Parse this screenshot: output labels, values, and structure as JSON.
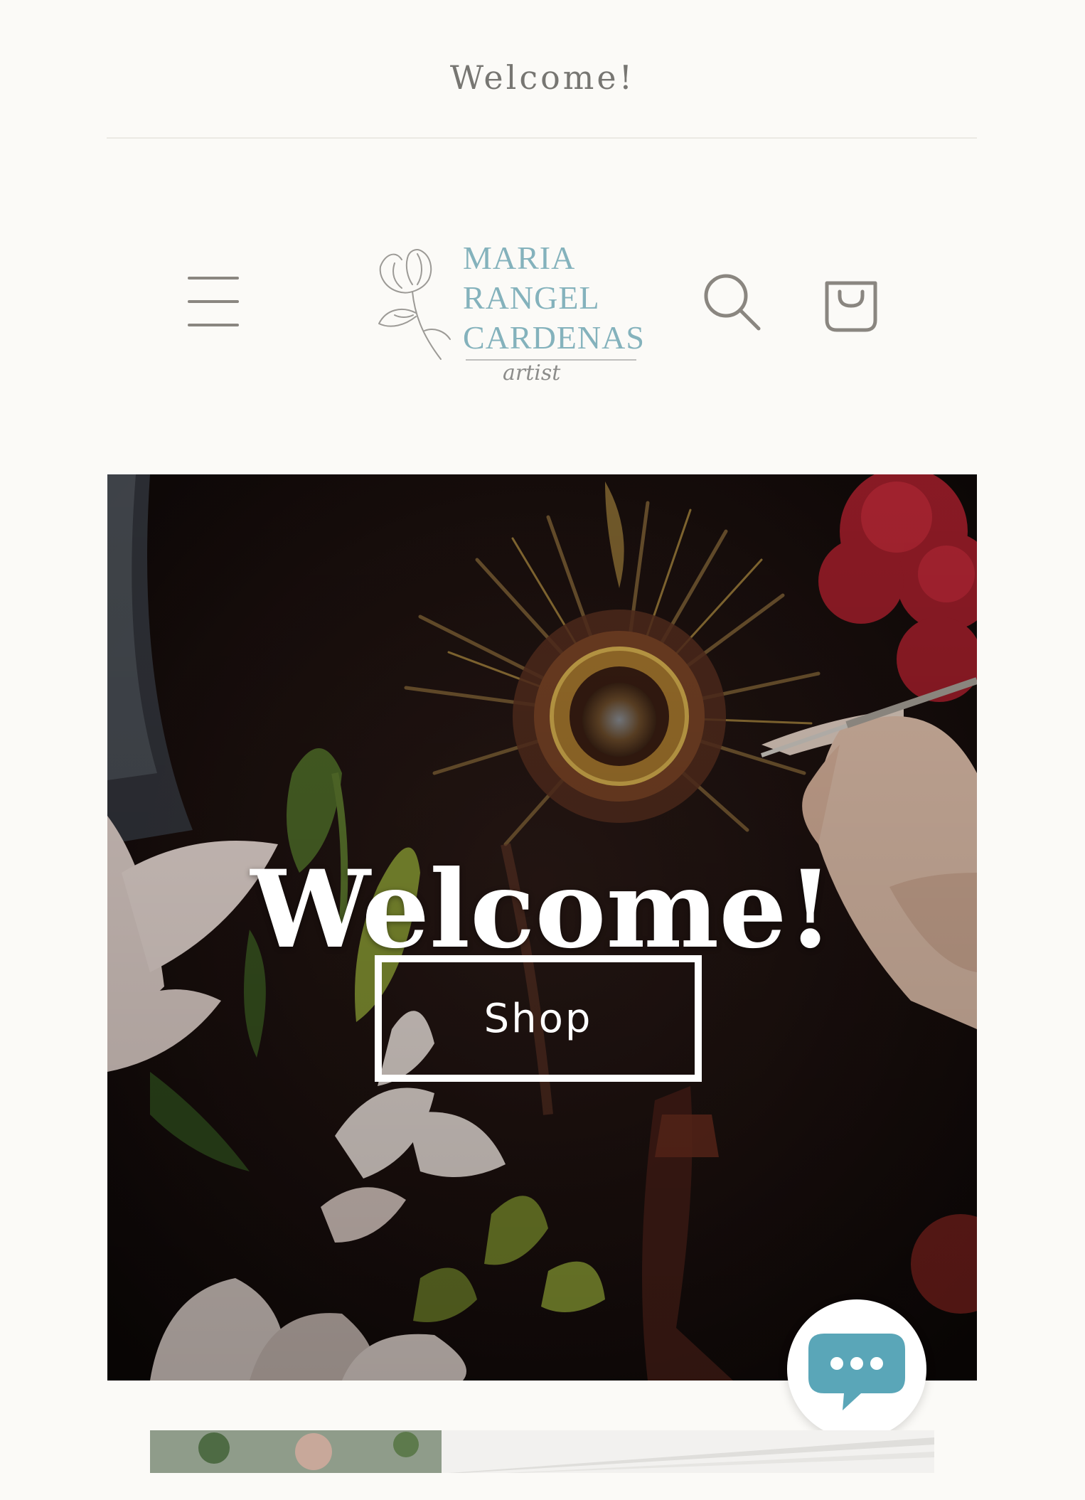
{
  "announcement": {
    "text": "Welcome!"
  },
  "header": {
    "logo": {
      "line1": "MARIA",
      "line2": "RANGEL",
      "line3": "CARDENAS",
      "subtitle": "artist"
    },
    "icons": {
      "menu": "hamburger-menu-icon",
      "search": "search-icon",
      "cart": "shopping-bag-icon"
    }
  },
  "hero": {
    "title": "Welcome!",
    "button_label": "Shop"
  },
  "chat": {
    "icon": "chat-bubble-icon"
  },
  "colors": {
    "background": "#fbfaf7",
    "logo_accent": "#84b2bc",
    "icon_gray": "#8a8680",
    "chat_accent": "#5aa6b8"
  }
}
